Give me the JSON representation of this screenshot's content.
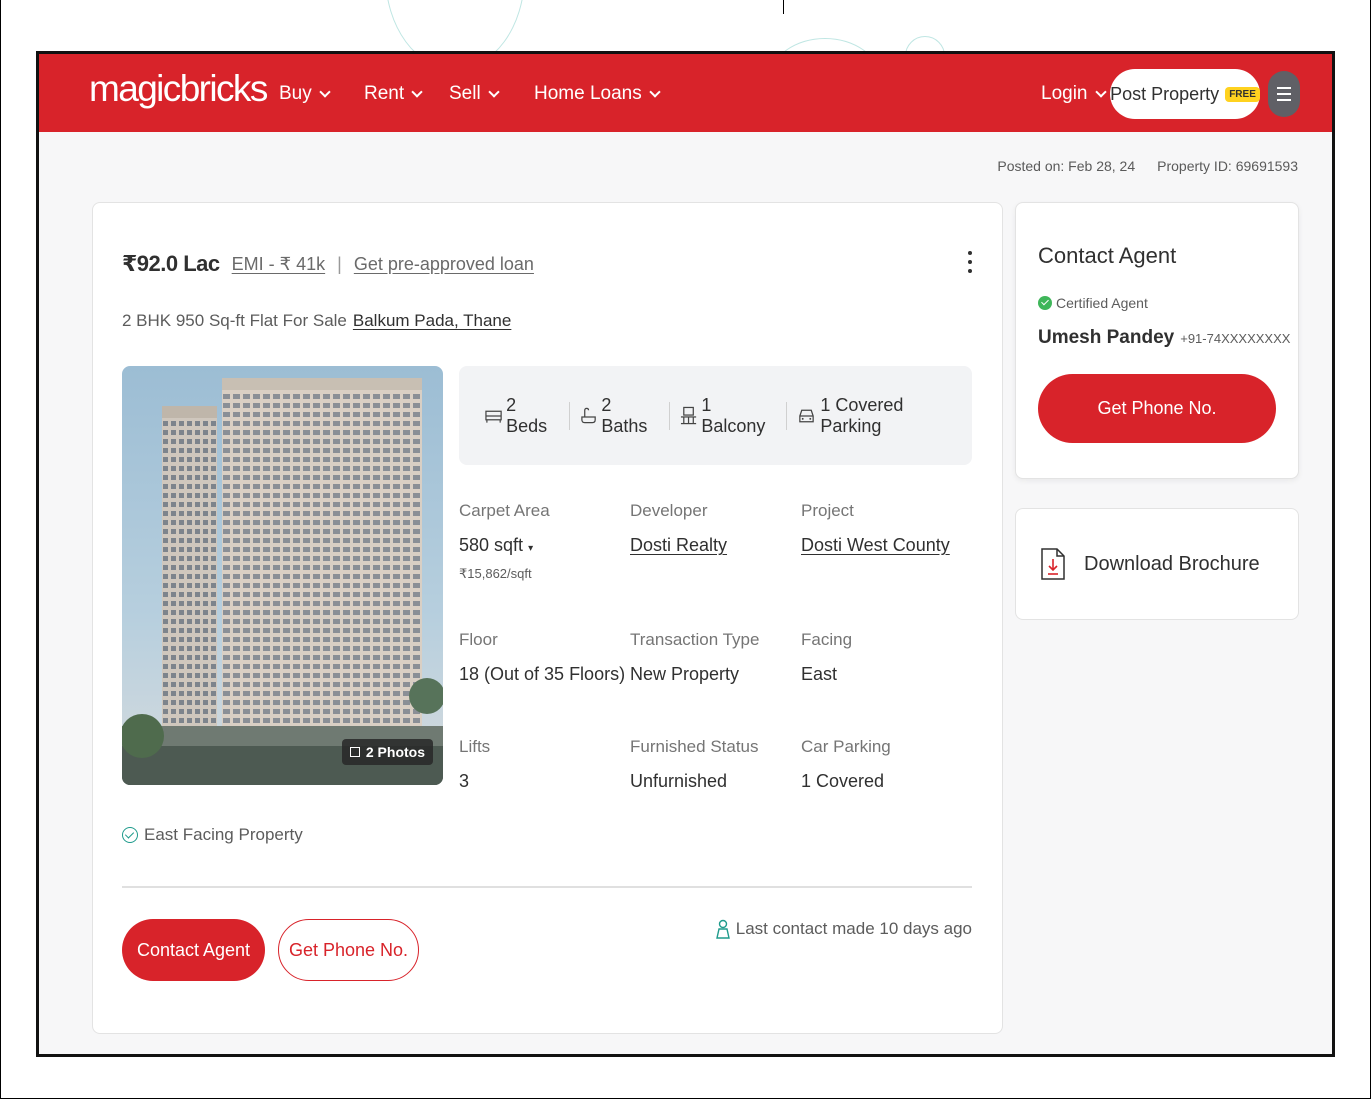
{
  "header": {
    "logo": "magicbricks",
    "nav": [
      {
        "label": "Buy"
      },
      {
        "label": "Rent"
      },
      {
        "label": "Sell"
      },
      {
        "label": "Home Loans"
      }
    ],
    "login_label": "Login",
    "post_property_label": "Post Property",
    "free_badge": "FREE",
    "menu_icon": "hamburger-icon"
  },
  "meta": {
    "posted_on": "Posted on: Feb 28, 24",
    "property_id": "Property ID: 69691593"
  },
  "listing": {
    "price": "₹92.0 Lac",
    "emi": "EMI - ₹ 41k",
    "separator": "|",
    "loan_link": "Get pre-approved loan",
    "title": "2 BHK 950 Sq-ft Flat For Sale",
    "locality": "Balkum Pada, Thane",
    "photo_badge": "2 Photos",
    "amenities": [
      {
        "icon": "bed-icon",
        "label": "2 Beds"
      },
      {
        "icon": "bath-icon",
        "label": "2 Baths"
      },
      {
        "icon": "balcony-icon",
        "label": "1 Balcony"
      },
      {
        "icon": "car-icon",
        "label": "1 Covered Parking"
      }
    ],
    "specs": {
      "carpet_area": {
        "label": "Carpet Area",
        "value": "580 sqft",
        "sub": "₹15,862/sqft"
      },
      "developer": {
        "label": "Developer",
        "value": "Dosti Realty"
      },
      "project": {
        "label": "Project",
        "value": "Dosti West County"
      },
      "floor": {
        "label": "Floor",
        "value": "18 (Out of 35 Floors)"
      },
      "transaction": {
        "label": "Transaction Type",
        "value": "New Property"
      },
      "facing": {
        "label": "Facing",
        "value": "East"
      },
      "lifts": {
        "label": "Lifts",
        "value": "3"
      },
      "furnished": {
        "label": "Furnished Status",
        "value": "Unfurnished"
      },
      "car_parking": {
        "label": "Car Parking",
        "value": "1 Covered"
      }
    },
    "highlight": "East Facing Property",
    "contact_button": "Contact Agent",
    "phone_button": "Get Phone No.",
    "last_contact": "Last contact made 10 days ago"
  },
  "agent_card": {
    "title": "Contact Agent",
    "certified": "Certified Agent",
    "name": "Umesh Pandey",
    "phone": "+91-74XXXXXXXX",
    "button": "Get Phone No."
  },
  "brochure": {
    "label": "Download Brochure"
  },
  "colors": {
    "brand_red": "#d8232a",
    "free_yellow": "#ffd21f",
    "accent_teal": "#1f9b8c",
    "cert_green": "#3fb65a"
  }
}
